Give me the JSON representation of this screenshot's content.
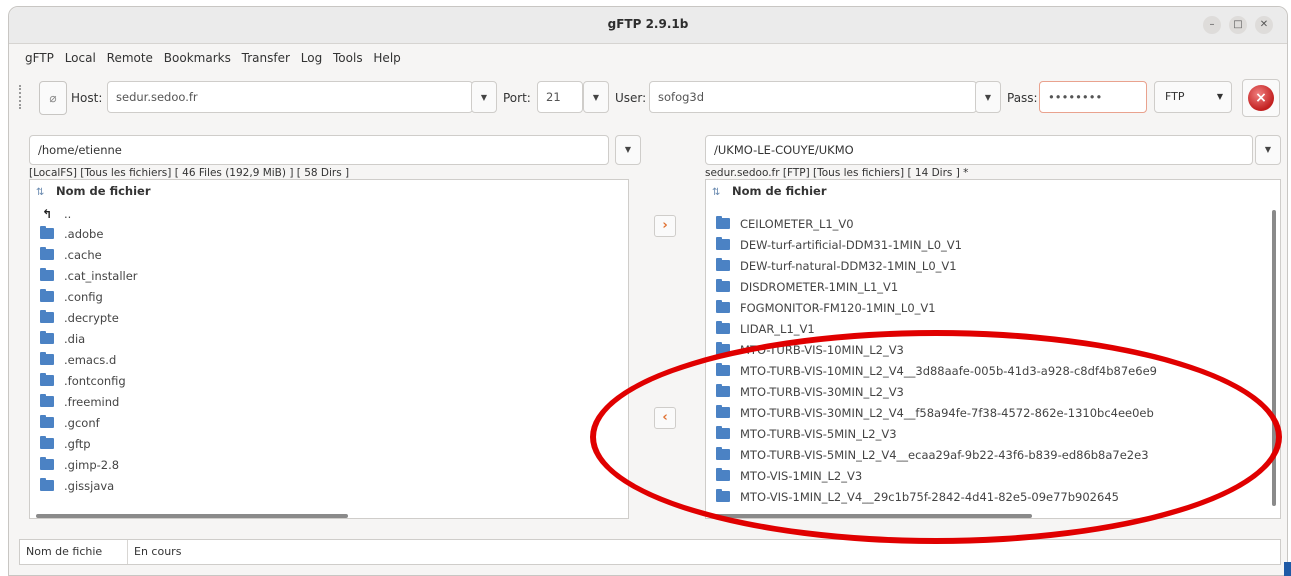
{
  "window": {
    "title": "gFTP 2.9.1b"
  },
  "menu": [
    "gFTP",
    "Local",
    "Remote",
    "Bookmarks",
    "Transfer",
    "Log",
    "Tools",
    "Help"
  ],
  "toolbar": {
    "host_label": "Host:",
    "host_value": "sedur.sedoo.fr",
    "port_label": "Port:",
    "port_value": "21",
    "user_label": "User:",
    "user_value": "sofog3d",
    "pass_label": "Pass:",
    "pass_value": "••••••••",
    "protocol": "FTP"
  },
  "local": {
    "path": "/home/etienne",
    "status": "[LocalFS] [Tous les fichiers] [ 46 Files (192,9 MiB) ] [ 58 Dirs ]",
    "column": "Nom de fichier",
    "items": [
      "..",
      ".adobe",
      ".cache",
      ".cat_installer",
      ".config",
      ".decrypte",
      ".dia",
      ".emacs.d",
      ".fontconfig",
      ".freemind",
      ".gconf",
      ".gftp",
      ".gimp-2.8",
      ".gissjava"
    ]
  },
  "remote": {
    "path": "/UKMO-LE-COUYE/UKMO",
    "status": "sedur.sedoo.fr [FTP] [Tous les fichiers] [ 14 Dirs ] *",
    "column": "Nom de fichier",
    "items": [
      "CEILOMETER_L1_V0",
      "DEW-turf-artificial-DDM31-1MIN_L0_V1",
      "DEW-turf-natural-DDM32-1MIN_L0_V1",
      "DISDROMETER-1MIN_L1_V1",
      "FOGMONITOR-FM120-1MIN_L0_V1",
      "LIDAR_L1_V1",
      "MTO-TURB-VIS-10MIN_L2_V3",
      "MTO-TURB-VIS-10MIN_L2_V4__3d88aafe-005b-41d3-a928-c8df4b87e6e9",
      "MTO-TURB-VIS-30MIN_L2_V3",
      "MTO-TURB-VIS-30MIN_L2_V4__f58a94fe-7f38-4572-862e-1310bc4ee0eb",
      "MTO-TURB-VIS-5MIN_L2_V3",
      "MTO-TURB-VIS-5MIN_L2_V4__ecaa29af-9b22-43f6-b839-ed86b8a7e2e3",
      "MTO-VIS-1MIN_L2_V3",
      "MTO-VIS-1MIN_L2_V4__29c1b75f-2842-4d41-82e5-09e77b902645"
    ]
  },
  "transfer": {
    "upload_glyph": "›",
    "download_glyph": "‹"
  },
  "queue": {
    "col_filename": "Nom de fichie",
    "col_progress": "En cours"
  },
  "colors": {
    "annotation": "#e00000",
    "folder": "#4b82c4",
    "accent": "#e07030"
  }
}
